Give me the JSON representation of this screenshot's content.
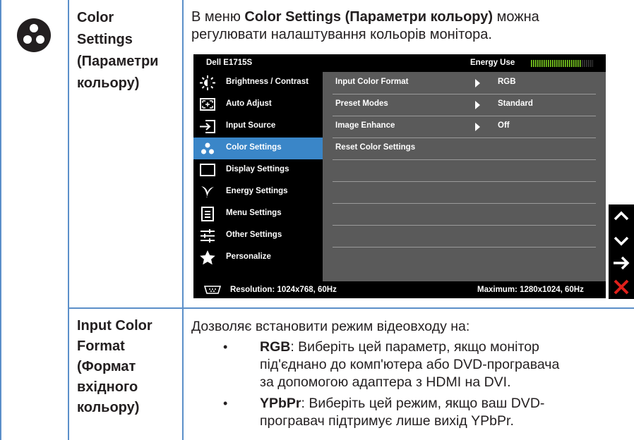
{
  "row1": {
    "param_lines": [
      "Color",
      "Settings",
      "(Параметри",
      "кольору)"
    ],
    "intro": {
      "line1_pre": "В меню ",
      "line1_bold": "Color Settings (Параметри кольору)",
      "line1_post": " можна",
      "line2": "регулювати налаштування кольорів монітора."
    }
  },
  "osd": {
    "model": "Dell E1715S",
    "energy_label": "Energy Use",
    "energy_level": 0.8,
    "menu": [
      {
        "label": "Brightness / Contrast",
        "icon": "brightness-icon",
        "active": false
      },
      {
        "label": "Auto Adjust",
        "icon": "auto-adjust-icon",
        "active": false
      },
      {
        "label": "Input Source",
        "icon": "input-source-icon",
        "active": false
      },
      {
        "label": "Color Settings",
        "icon": "color-settings-icon",
        "active": true
      },
      {
        "label": "Display Settings",
        "icon": "display-settings-icon",
        "active": false
      },
      {
        "label": "Energy Settings",
        "icon": "energy-settings-icon",
        "active": false
      },
      {
        "label": "Menu Settings",
        "icon": "menu-settings-icon",
        "active": false
      },
      {
        "label": "Other Settings",
        "icon": "other-settings-icon",
        "active": false
      },
      {
        "label": "Personalize",
        "icon": "star-icon",
        "active": false
      }
    ],
    "options": [
      {
        "label": "Input Color Format",
        "value": "RGB"
      },
      {
        "label": "Preset Modes",
        "value": "Standard"
      },
      {
        "label": "Image Enhance",
        "value": "Off"
      },
      {
        "label": "Reset Color Settings",
        "value": ""
      }
    ],
    "resolution": "Resolution: 1024x768, 60Hz",
    "maximum": "Maximum: 1280x1024, 60Hz"
  },
  "side_buttons": [
    "up-arrow-icon",
    "down-arrow-icon",
    "right-arrow-icon",
    "close-icon"
  ],
  "colors": {
    "accent": "#3a86c8",
    "rule": "#5b8fc9",
    "close": "#e0201b",
    "energy": "#7ed321"
  },
  "row2": {
    "param_lines": [
      "Input Color",
      "Format",
      "(Формат",
      "вхідного",
      "кольору)"
    ],
    "intro": "Дозволяє встановити режим відеовходу на:",
    "bullet_char": "•",
    "bullets": [
      {
        "bold": "RGB",
        "lines": [
          ": Виберіть цей параметр, якщо монітор",
          "під'єднано до комп'ютера або DVD-програвача",
          "за допомогою адаптера з HDMI на DVI."
        ]
      },
      {
        "bold": "YPbPr",
        "lines": [
          ": Виберіть цей режим, якщо ваш DVD-",
          "програвач підтримує лише вихід YPbPr."
        ]
      }
    ]
  }
}
